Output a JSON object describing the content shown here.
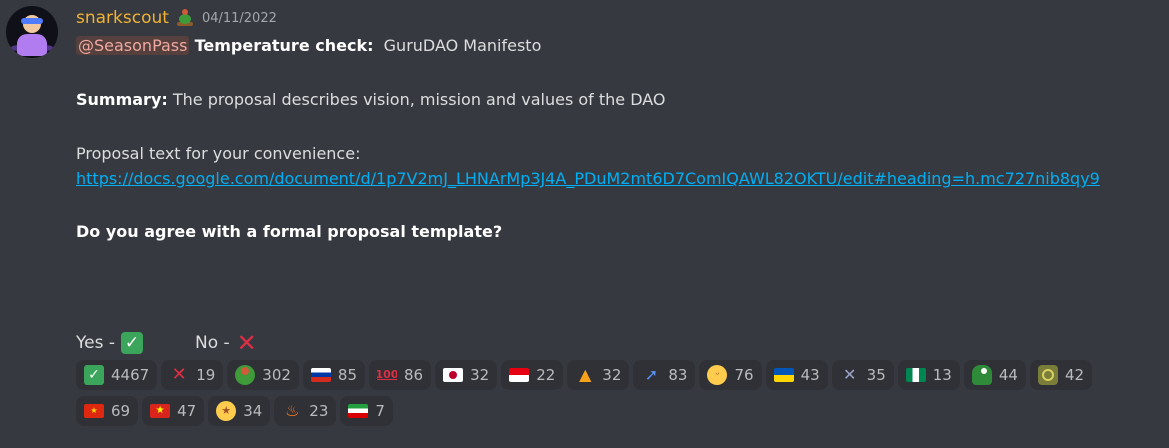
{
  "message": {
    "author": "snarkscout",
    "timestamp": "04/11/2022",
    "mention": "@SeasonPass",
    "title_bold": "Temperature check:",
    "title_rest": "GuruDAO Manifesto",
    "summary_label": "Summary:",
    "summary_text": "The proposal describes vision, mission and values of the DAO",
    "proposal_intro": "Proposal text for your convenience:",
    "proposal_link": "https://docs.google.com/document/d/1p7V2mJ_LHNArMp3J4A_PDuM2mt6D7ComIQAWL82OKTU/edit#heading=h.mc727nib8qy9",
    "question": "Do you agree with a formal proposal template?",
    "yes_label": "Yes -",
    "no_label": "No -"
  },
  "reactions": [
    {
      "icon": "check-mark-icon",
      "glyph": "✓",
      "count": "4467"
    },
    {
      "icon": "cross-mark-icon",
      "glyph": "✕",
      "count": "19"
    },
    {
      "icon": "dao-turtle-icon",
      "glyph": "",
      "count": "302"
    },
    {
      "icon": "flag-russia-icon",
      "glyph": "",
      "count": "85"
    },
    {
      "icon": "hundred-points-icon",
      "glyph": "100",
      "count": "86"
    },
    {
      "icon": "flag-japan-icon",
      "glyph": "",
      "count": "32"
    },
    {
      "icon": "flag-indonesia-icon",
      "glyph": "",
      "count": "22"
    },
    {
      "icon": "bell-icon",
      "glyph": "▲",
      "count": "32"
    },
    {
      "icon": "rocket-icon",
      "glyph": "➚",
      "count": "83"
    },
    {
      "icon": "yum-face-icon",
      "glyph": "ᵕ",
      "count": "76"
    },
    {
      "icon": "flag-ukraine-icon",
      "glyph": "",
      "count": "43"
    },
    {
      "icon": "tools-icon",
      "glyph": "✕",
      "count": "35"
    },
    {
      "icon": "flag-nigeria-icon",
      "glyph": "",
      "count": "13"
    },
    {
      "icon": "dino-icon",
      "glyph": "",
      "count": "44"
    },
    {
      "icon": "coin-icon",
      "glyph": "",
      "count": "42"
    },
    {
      "icon": "flag-china-icon",
      "glyph": "★",
      "count": "69"
    },
    {
      "icon": "flag-vietnam-icon",
      "glyph": "★",
      "count": "47"
    },
    {
      "icon": "star-struck-face-icon",
      "glyph": "★",
      "count": "34"
    },
    {
      "icon": "fire-icon",
      "glyph": "♨",
      "count": "23"
    },
    {
      "icon": "flag-iran-icon",
      "glyph": "",
      "count": "7"
    }
  ],
  "colors": {
    "background": "#36393f",
    "username": "#f0b232",
    "link": "#00aff4",
    "reaction_bg": "#2f3136",
    "mention_bg": "#55403d"
  }
}
